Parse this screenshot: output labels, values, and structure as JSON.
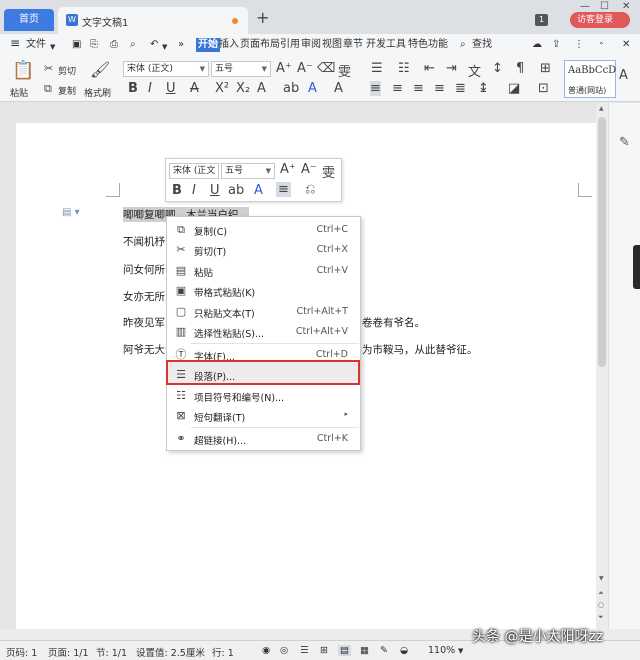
{
  "tabs": {
    "home": "首页",
    "doc": "文字文稿1"
  },
  "window": {
    "badge": "1",
    "login": "访客登录"
  },
  "menubar": {
    "file": "文件",
    "items": [
      "开始",
      "插入",
      "页面布局",
      "引用",
      "审阅",
      "视图",
      "章节",
      "开发工具",
      "特色功能"
    ],
    "search": "查找"
  },
  "ribbon": {
    "paste": "粘贴",
    "cut": "剪切",
    "copy": "复制",
    "format_painter": "格式刷",
    "font_name": "宋体 (正文)",
    "font_size": "五号",
    "style_preview": "AaBbCcD",
    "style_name": "普通(网站)"
  },
  "document": {
    "lines": [
      "唧唧复唧唧，木兰当户织，",
      "不闻机杼",
      "问女何所",
      "女亦无所",
      "昨夜见军",
      "阿爷无大"
    ],
    "right_tails": [
      "卷卷有爷名。",
      "为市鞍马，从此替爷征。"
    ]
  },
  "mini_toolbar": {
    "font_name": "宋体 (正文",
    "font_size": "五号"
  },
  "context_menu": {
    "items": [
      {
        "label": "复制(C)",
        "shortcut": "Ctrl+C"
      },
      {
        "label": "剪切(T)",
        "shortcut": "Ctrl+X"
      },
      {
        "label": "粘贴",
        "shortcut": "Ctrl+V"
      },
      {
        "label": "带格式粘贴(K)",
        "shortcut": ""
      },
      {
        "label": "只粘贴文本(T)",
        "shortcut": "Ctrl+Alt+T"
      },
      {
        "label": "选择性粘贴(S)...",
        "shortcut": "Ctrl+Alt+V"
      },
      {
        "label": "字体(F)...",
        "shortcut": "Ctrl+D"
      },
      {
        "label": "段落(P)...",
        "shortcut": ""
      },
      {
        "label": "项目符号和编号(N)...",
        "shortcut": ""
      },
      {
        "label": "短句翻译(T)",
        "shortcut": ""
      },
      {
        "label": "超链接(H)...",
        "shortcut": "Ctrl+K"
      }
    ]
  },
  "status": {
    "page": "页码: 1",
    "pages": "页面: 1/1",
    "section": "节: 1/1",
    "setting": "设置值: 2.5厘米",
    "row": "行: 1",
    "zoom": "110%"
  },
  "watermark": "头条 @是小太阳呀zz",
  "colors": {
    "accent": "#3b74d8",
    "highlight_box": "#e03030",
    "login": "#e25757"
  }
}
